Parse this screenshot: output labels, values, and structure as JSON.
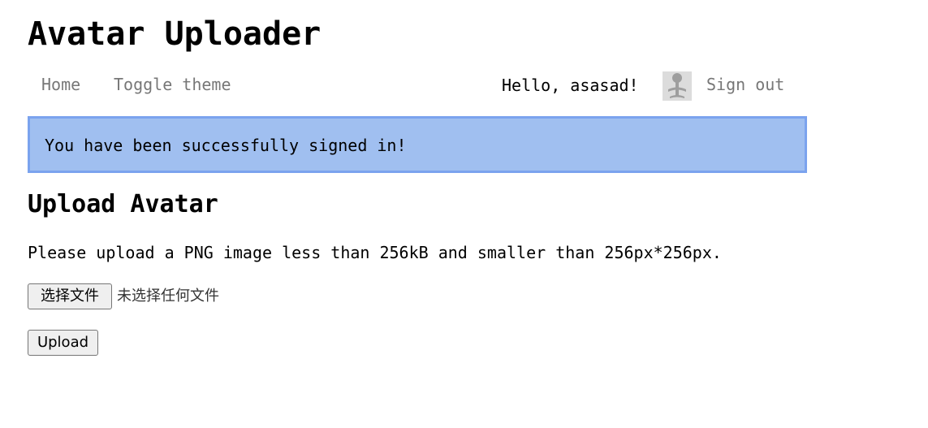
{
  "header": {
    "title": "Avatar Uploader"
  },
  "nav": {
    "home": "Home",
    "toggle_theme": "Toggle theme",
    "greeting": "Hello, asasad!",
    "avatar_icon": "default-user-avatar",
    "sign_out": "Sign out"
  },
  "flash": {
    "message": "You have been successfully signed in!",
    "background": "#a0bff0",
    "border": "#7ba3ee"
  },
  "main": {
    "heading": "Upload Avatar",
    "instructions": "Please upload a PNG image less than 256kB and smaller than 256px*256px.",
    "file_button_label": "选择文件",
    "file_status": "未选择任何文件",
    "upload_label": "Upload"
  }
}
